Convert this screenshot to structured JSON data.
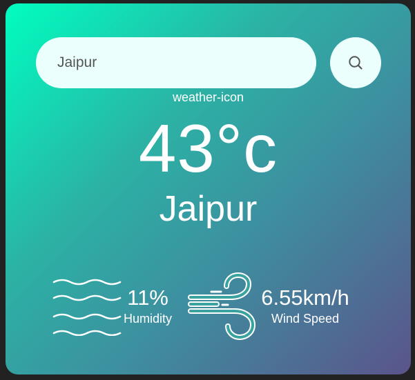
{
  "search": {
    "value": "Jaipur",
    "button_icon": "search-icon"
  },
  "weather": {
    "icon_alt_text": "weather-icon",
    "temperature": "43°c",
    "city": "Jaipur"
  },
  "details": {
    "humidity": {
      "icon": "humidity-waves-icon",
      "value": "11%",
      "label": "Humidity"
    },
    "wind": {
      "icon": "wind-icon",
      "value": "6.55km/h",
      "label": "Wind Speed"
    }
  },
  "colors": {
    "gradient_start": "#00fec0",
    "gradient_end": "#5b548b",
    "input_background": "#ebfffc",
    "page_background": "#222222",
    "text": "#ffffff"
  }
}
